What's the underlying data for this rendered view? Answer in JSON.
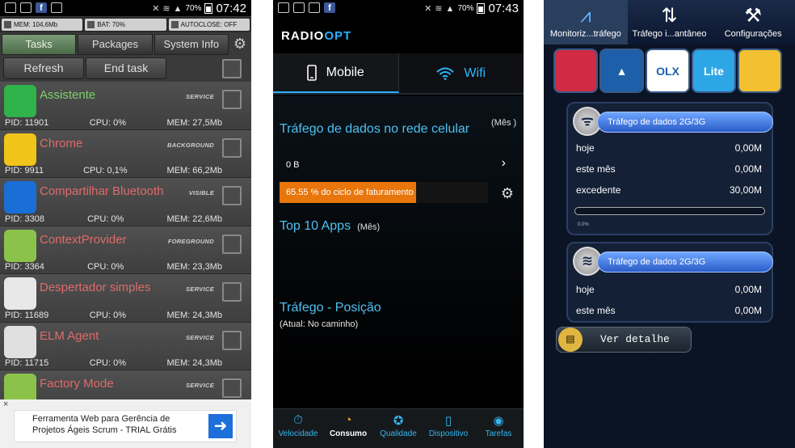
{
  "phone1": {
    "statusbar": {
      "time": "07:42",
      "battery": "70%"
    },
    "info": [
      "MEM: 104,6Mb",
      "BAT: 70%",
      "AUTOCLOSE: OFF"
    ],
    "tabs": [
      "Tasks",
      "Packages",
      "System Info"
    ],
    "refresh_label": "Refresh",
    "endtask_label": "End task",
    "processes": [
      {
        "name": "Assistente",
        "tag": "SERVICE",
        "pid": "PID: 11901",
        "cpu": "CPU: 0%",
        "mem": "MEM: 27,5Mb",
        "icon": "assistente-icon",
        "color": "#2fb34a"
      },
      {
        "name": "Chrome",
        "tag": "BACKGROUND",
        "pid": "PID: 9911",
        "cpu": "CPU: 0,1%",
        "mem": "MEM: 66,2Mb",
        "icon": "chrome-icon",
        "color": "#f0c419"
      },
      {
        "name": "Compartilhar Bluetooth",
        "tag": "VISIBLE",
        "pid": "PID: 3308",
        "cpu": "CPU: 0%",
        "mem": "MEM: 22,6Mb",
        "icon": "bluetooth-icon",
        "color": "#1a6fd6"
      },
      {
        "name": "ContextProvider",
        "tag": "FOREGROUND",
        "pid": "PID: 3364",
        "cpu": "CPU: 0%",
        "mem": "MEM: 23,3Mb",
        "icon": "android-icon",
        "color": "#8bc34a"
      },
      {
        "name": "Despertador simples",
        "tag": "SERVICE",
        "pid": "PID: 11689",
        "cpu": "CPU: 0%",
        "mem": "MEM: 24,3Mb",
        "icon": "alarm-clock-icon",
        "color": "#e8e8e8"
      },
      {
        "name": "ELM Agent",
        "tag": "SERVICE",
        "pid": "PID: 11715",
        "cpu": "CPU: 0%",
        "mem": "MEM: 24,3Mb",
        "icon": "key-icon",
        "color": "#e0e0e0"
      },
      {
        "name": "Factory Mode",
        "tag": "SERVICE",
        "pid": "",
        "cpu": "",
        "mem": "",
        "icon": "android-icon",
        "color": "#8bc34a"
      }
    ],
    "ad": {
      "close": "×",
      "text": "Ferramenta Web para Gerência de Projetos Ágeis Scrum - TRIAL Grátis"
    }
  },
  "phone2": {
    "statusbar": {
      "time": "07:43",
      "battery": "70%"
    },
    "logo_a": "RADIO",
    "logo_b": "OPT",
    "tabs": {
      "mobile": "Mobile",
      "wifi": "Wifi"
    },
    "section_title": "Tráfego de dados no rede celular",
    "period": "(Mês )",
    "usage": "0 B",
    "billing_text": "65.55 % do ciclo de faturamento",
    "billing_percent": 65.55,
    "top_apps": "Top 10 Apps",
    "top_apps_period": "(Mês)",
    "position_title": "Tráfego - Posição",
    "position_sub": "(Atual: No caminho)",
    "nav": [
      {
        "label": "Velocidade",
        "icon": "stopwatch-icon",
        "glyph": "⏱",
        "active": false
      },
      {
        "label": "Consumo",
        "icon": "pie-chart-icon",
        "glyph": "◔",
        "active": true
      },
      {
        "label": "Qualidade",
        "icon": "badge-icon",
        "glyph": "✪",
        "active": false
      },
      {
        "label": "Dispositivo",
        "icon": "phone-icon",
        "glyph": "▯",
        "active": false
      },
      {
        "label": "Tarefas",
        "icon": "tasks-icon",
        "glyph": "◉",
        "active": false
      }
    ]
  },
  "phone3": {
    "tabs": [
      {
        "label": "Monitoriz...tráfego",
        "icon": "chart-icon",
        "glyph": "⩘",
        "active": true
      },
      {
        "label": "Tráfego i...antâneo",
        "icon": "updown-arrows-icon",
        "glyph": "⇅",
        "active": false
      },
      {
        "label": "Configurações",
        "icon": "tools-icon",
        "glyph": "⚒",
        "active": false
      }
    ],
    "apps": [
      {
        "name": "candy-crush-icon",
        "label": "",
        "color": "#d02a44"
      },
      {
        "name": "arrow-app-icon",
        "label": "▲",
        "color": "#1d5fa8"
      },
      {
        "name": "olx-icon",
        "label": "OLX",
        "color": "#ffffff"
      },
      {
        "name": "lite-app-icon",
        "label": "Lite",
        "color": "#2da6e6"
      },
      {
        "name": "game-app-icon",
        "label": "",
        "color": "#f2c030"
      }
    ],
    "card1": {
      "title": "Tráfego de dados 2G/3G",
      "rows": [
        {
          "label": "hoje",
          "value": "0,00M"
        },
        {
          "label": "este mês",
          "value": "0,00M"
        },
        {
          "label": "excedente",
          "value": "30,00M"
        }
      ],
      "progress_label": "0,0%"
    },
    "card2": {
      "title": "Tráfego de dados 2G/3G",
      "rows": [
        {
          "label": "hoje",
          "value": "0,00M"
        },
        {
          "label": "este mês",
          "value": "0,00M"
        }
      ]
    },
    "detail_button": "Ver detalhe"
  }
}
